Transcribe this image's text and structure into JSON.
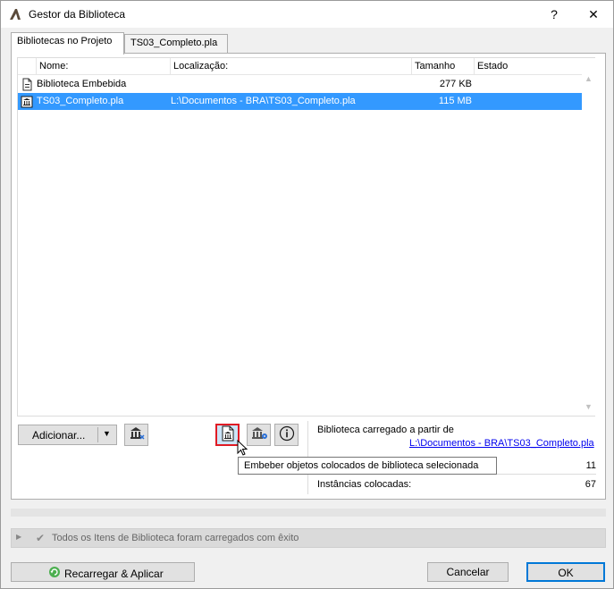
{
  "window": {
    "title": "Gestor da Biblioteca",
    "help_label": "?",
    "close_label": "✕"
  },
  "tabs": [
    {
      "label": "Bibliotecas no Projeto",
      "active": true
    },
    {
      "label": "TS03_Completo.pla",
      "active": false
    }
  ],
  "table": {
    "headers": {
      "name": "Nome:",
      "location": "Localização:",
      "size": "Tamanho",
      "state": "Estado"
    },
    "rows": [
      {
        "name": "Biblioteca Embebida",
        "location": "",
        "size": "277 KB",
        "selected": false
      },
      {
        "name": "TS03_Completo.pla",
        "location": "L:\\Documentos - BRA\\TS03_Completo.pla",
        "size": "115 MB",
        "selected": true
      }
    ]
  },
  "toolbar": {
    "add_label": "Adicionar...",
    "tooltip": "Embeber objetos colocados de biblioteca selecionada"
  },
  "info": {
    "loaded_from_label": "Biblioteca carregado a partir de",
    "loaded_from_path": "L:\\Documentos - BRA\\TS03_Completo.pla",
    "count": "11",
    "instances_label": "Instâncias colocadas:",
    "instances_value": "67"
  },
  "status": {
    "message": "Todos os Itens de Biblioteca foram carregados com êxito"
  },
  "buttons": {
    "reload": "Recarregar & Aplicar",
    "cancel": "Cancelar",
    "ok": "OK"
  },
  "colors": {
    "selection": "#3399ff",
    "highlight_border": "#e01b24",
    "link": "#0000ee",
    "default_button_border": "#0078d7"
  }
}
